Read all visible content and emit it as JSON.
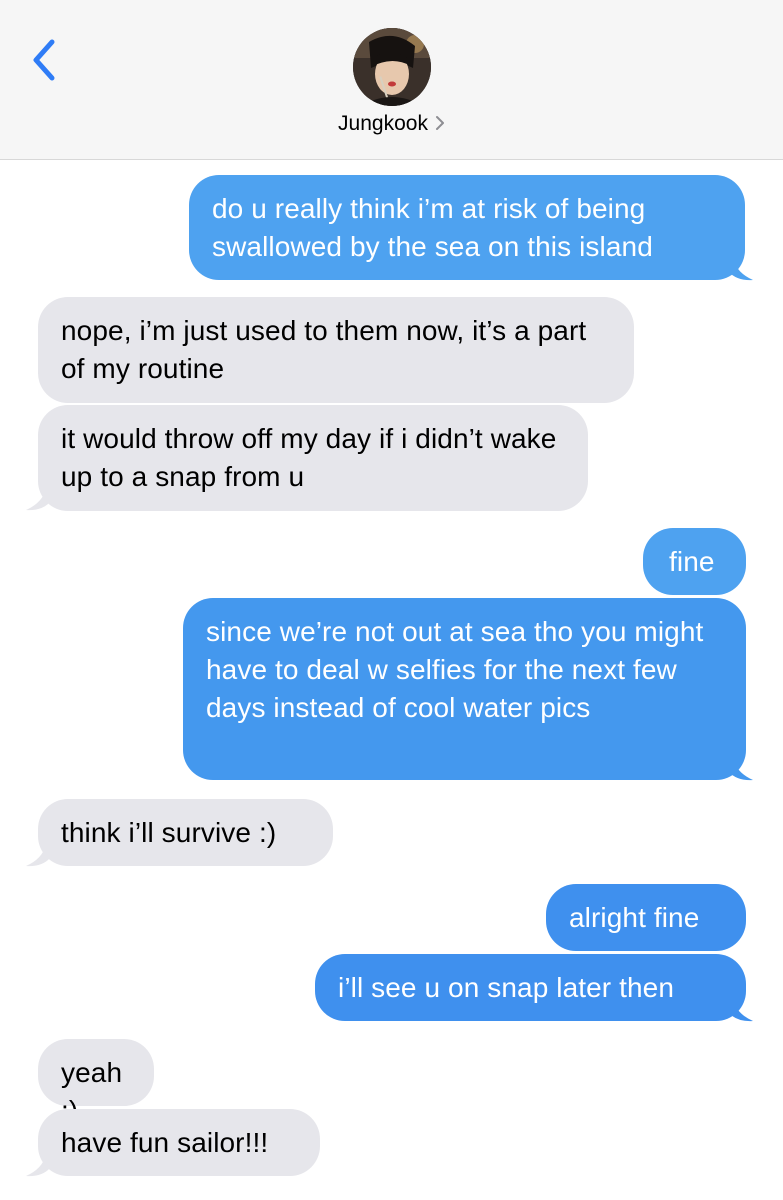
{
  "header": {
    "contact_name": "Jungkook",
    "back_icon": "chevron-left-icon",
    "detail_icon": "chevron-right-icon"
  },
  "colors": {
    "outgoing_bubble": "#4ea2f0",
    "outgoing_bubble_dark": "#3f90ee",
    "incoming_bubble": "#e6e6eb",
    "ios_blue": "#2f7cf6"
  },
  "messages": [
    {
      "sender": "me",
      "text": "do u really think i’m at risk of being swallowed by the sea on this island"
    },
    {
      "sender": "Jungkook",
      "text": "nope, i’m just used to them now, it’s a part of my routine"
    },
    {
      "sender": "Jungkook",
      "text": "it would throw off my day if i didn’t wake up to a snap from u"
    },
    {
      "sender": "me",
      "text": "fine"
    },
    {
      "sender": "me",
      "text": "since we’re not out at sea tho you might have to deal w selfies for the next few days instead of cool water pics"
    },
    {
      "sender": "Jungkook",
      "text": "think i’ll survive :)"
    },
    {
      "sender": "me",
      "text": "alright fine"
    },
    {
      "sender": "me",
      "text": "i’ll see u on snap later then"
    },
    {
      "sender": "Jungkook",
      "text": "yeah :)"
    },
    {
      "sender": "Jungkook",
      "text": "have fun sailor!!!"
    }
  ]
}
